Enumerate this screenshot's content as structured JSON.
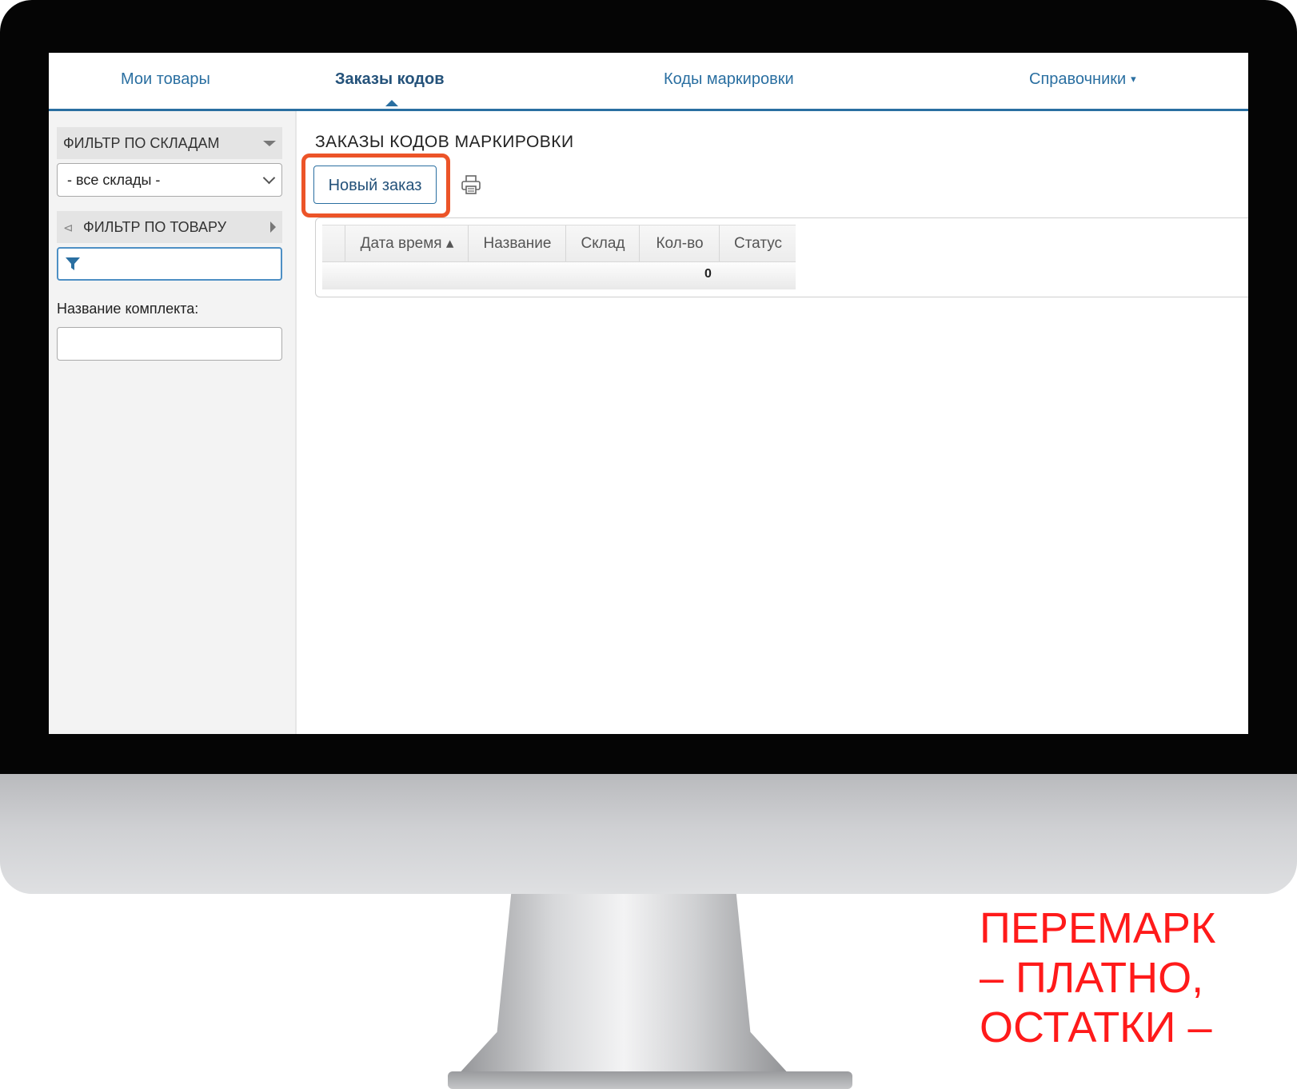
{
  "nav": {
    "items": [
      {
        "label": "Мои товары"
      },
      {
        "label": "Заказы кодов"
      },
      {
        "label": "Коды маркировки"
      },
      {
        "label": "Справочники"
      }
    ],
    "active": "Заказы кодов",
    "dropdown_caret": "▾"
  },
  "sidebar": {
    "warehouse_filter_title": "ФИЛЬТР ПО СКЛАДАМ",
    "warehouse_select_value": "- все склады -",
    "product_filter_title": "ФИЛЬТР ПО ТОВАРУ",
    "product_filter_value": "",
    "kit_name_label": "Название комплекта:",
    "kit_name_value": ""
  },
  "main": {
    "title": "ЗАКАЗЫ КОДОВ МАРКИРОВКИ",
    "new_order_label": "Новый заказ",
    "table": {
      "columns": [
        "Дата время ▴",
        "Название",
        "Склад",
        "Кол-во",
        "Статус"
      ],
      "rows": [],
      "total_qty": "0"
    }
  },
  "caption": {
    "lines": [
      "ПЕРЕМАРК",
      "– ПЛАТНО,",
      "ОСТАТКИ –"
    ],
    "color": "#ff1a1a"
  },
  "colors": {
    "accent": "#2a6fa1",
    "highlight": "#ec5428"
  }
}
